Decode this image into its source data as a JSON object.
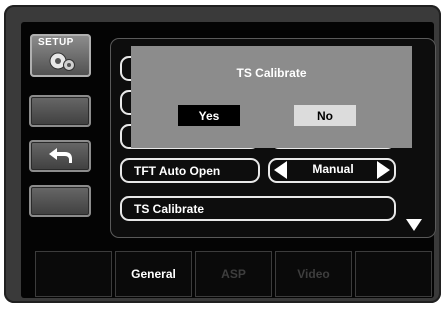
{
  "setup_button": {
    "label": "SETUP",
    "icon": "gears-icon"
  },
  "dialog": {
    "title": "TS Calibrate",
    "yes_label": "Yes",
    "no_label": "No"
  },
  "settings": {
    "tft_auto_open_label": "TFT Auto Open",
    "tft_auto_open_value": "Manual",
    "ts_calibrate_label": "TS Calibrate"
  },
  "tabs": [
    {
      "label": "General",
      "active": true
    },
    {
      "label": "ASP",
      "active": false
    },
    {
      "label": "Video",
      "active": false
    },
    {
      "label": "",
      "active": false
    },
    {
      "label": "",
      "active": false
    }
  ]
}
